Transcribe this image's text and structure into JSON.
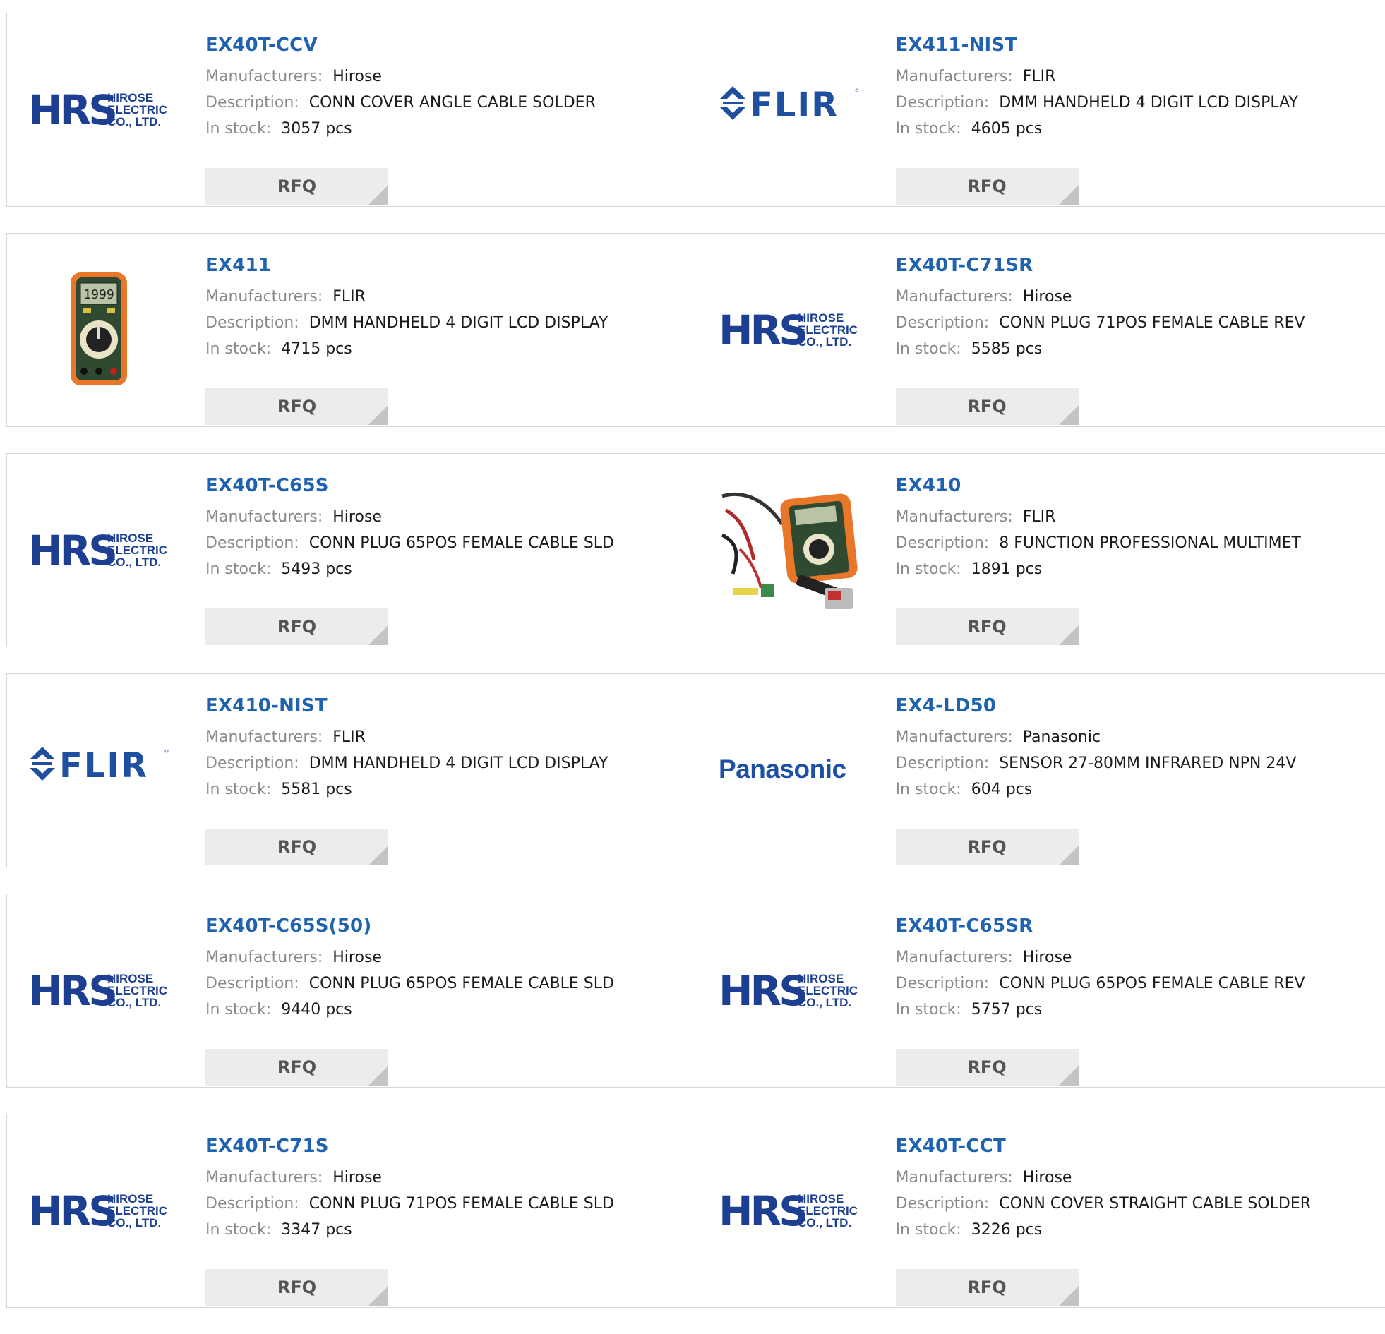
{
  "labels": {
    "manufacturers": "Manufacturers:",
    "description": "Description:",
    "in_stock": "In stock:",
    "rfq": "RFQ"
  },
  "logo_text": {
    "hrs_main": "HRS",
    "hrs_line1": "HIROSE",
    "hrs_line2": "ELECTRIC",
    "hrs_line3": "CO., LTD.",
    "flir": "FLIR",
    "panasonic": "Panasonic",
    "meter_display": "1999"
  },
  "colors": {
    "link": "#1f63b0",
    "hrs_blue": "#1d3f91",
    "flir_blue": "#1f4fa0",
    "panasonic_blue": "#1e4fa6"
  },
  "products": [
    {
      "pn": "EX40T-CCV",
      "manufacturer": "Hirose",
      "description": "CONN COVER ANGLE CABLE SOLDER",
      "stock": "3057 pcs",
      "logo": "hrs-logo-icon"
    },
    {
      "pn": "EX411-NIST",
      "manufacturer": "FLIR",
      "description": "DMM HANDHELD 4 DIGIT LCD DISPLAY",
      "stock": "4605 pcs",
      "logo": "flir-logo-icon"
    },
    {
      "pn": "EX411",
      "manufacturer": "FLIR",
      "description": "DMM HANDHELD 4 DIGIT LCD DISPLAY",
      "stock": "4715 pcs",
      "logo": "multimeter-image-icon"
    },
    {
      "pn": "EX40T-C71SR",
      "manufacturer": "Hirose",
      "description": "CONN PLUG 71POS FEMALE CABLE REV",
      "stock": "5585 pcs",
      "logo": "hrs-logo-icon"
    },
    {
      "pn": "EX40T-C65S",
      "manufacturer": "Hirose",
      "description": "CONN PLUG 65POS FEMALE CABLE SLD",
      "stock": "5493 pcs",
      "logo": "hrs-logo-icon"
    },
    {
      "pn": "EX410",
      "manufacturer": "FLIR",
      "description": "8 FUNCTION PROFESSIONAL MULTIMET",
      "stock": "1891 pcs",
      "logo": "multimeter-kit-image-icon"
    },
    {
      "pn": "EX410-NIST",
      "manufacturer": "FLIR",
      "description": "DMM HANDHELD 4 DIGIT LCD DISPLAY",
      "stock": "5581 pcs",
      "logo": "flir-logo-icon"
    },
    {
      "pn": "EX4-LD50",
      "manufacturer": "Panasonic",
      "description": "SENSOR 27-80MM INFRARED NPN 24V",
      "stock": "604 pcs",
      "logo": "panasonic-logo-icon"
    },
    {
      "pn": "EX40T-C65S(50)",
      "manufacturer": "Hirose",
      "description": "CONN PLUG 65POS FEMALE CABLE SLD",
      "stock": "9440 pcs",
      "logo": "hrs-logo-icon"
    },
    {
      "pn": "EX40T-C65SR",
      "manufacturer": "Hirose",
      "description": "CONN PLUG 65POS FEMALE CABLE REV",
      "stock": "5757 pcs",
      "logo": "hrs-logo-icon"
    },
    {
      "pn": "EX40T-C71S",
      "manufacturer": "Hirose",
      "description": "CONN PLUG 71POS FEMALE CABLE SLD",
      "stock": "3347 pcs",
      "logo": "hrs-logo-icon"
    },
    {
      "pn": "EX40T-CCT",
      "manufacturer": "Hirose",
      "description": "CONN COVER STRAIGHT CABLE SOLDER",
      "stock": "3226 pcs",
      "logo": "hrs-logo-icon"
    }
  ]
}
